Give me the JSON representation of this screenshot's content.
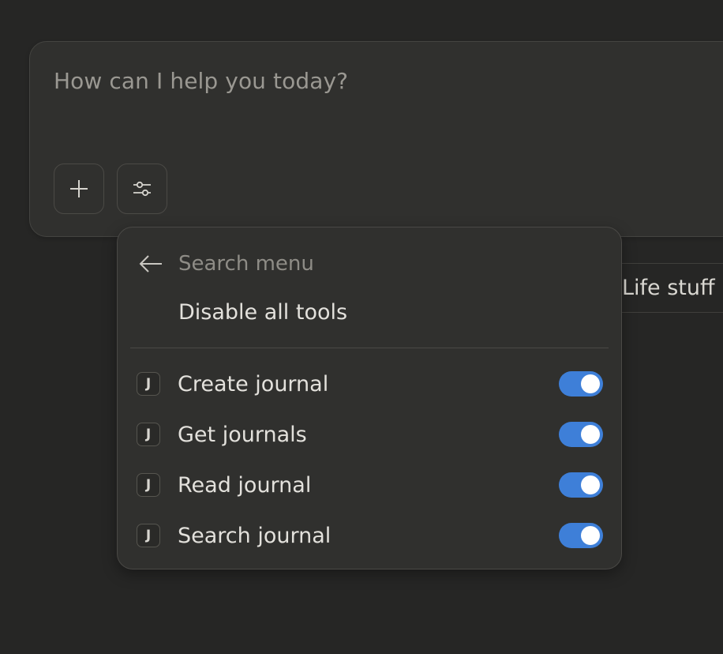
{
  "composer": {
    "placeholder": "How can I help you today?",
    "add_button_icon": "plus-icon",
    "tools_button_icon": "sliders-icon"
  },
  "project_chip": {
    "label": "Life stuff"
  },
  "menu": {
    "back_icon": "arrow-left-icon",
    "search_placeholder": "Search menu",
    "disable_all_label": "Disable all tools",
    "tools": [
      {
        "badge": "J",
        "label": "Create journal",
        "enabled": true
      },
      {
        "badge": "J",
        "label": "Get journals",
        "enabled": true
      },
      {
        "badge": "J",
        "label": "Read journal",
        "enabled": true
      },
      {
        "badge": "J",
        "label": "Search journal",
        "enabled": true
      }
    ]
  },
  "colors": {
    "background": "#262625",
    "surface": "#30302e",
    "toggle_on": "#3e7fd8"
  }
}
